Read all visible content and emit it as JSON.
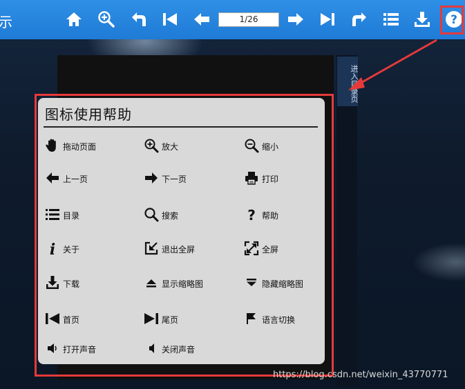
{
  "toolbar": {
    "left_partial_text": "示",
    "page_indicator": "1/26",
    "buttons": [
      "home-icon",
      "zoom-in-icon",
      "undo-icon",
      "first-page-icon",
      "prev-page-icon",
      "next-page-icon",
      "last-page-icon",
      "redo-icon",
      "contents-icon",
      "download-icon",
      "help-icon"
    ]
  },
  "side_tab": {
    "label": "进入目录页"
  },
  "dialog": {
    "title": "图标使用帮助",
    "items": [
      {
        "icon": "hand-icon",
        "label": "拖动页面"
      },
      {
        "icon": "zoom-in-icon",
        "label": "放大"
      },
      {
        "icon": "zoom-out-icon",
        "label": "缩小"
      },
      {
        "icon": "arrow-left-icon",
        "label": "上一页"
      },
      {
        "icon": "arrow-right-icon",
        "label": "下一页"
      },
      {
        "icon": "print-icon",
        "label": "打印"
      },
      {
        "icon": "list-icon",
        "label": "目录"
      },
      {
        "icon": "search-icon",
        "label": "搜索"
      },
      {
        "icon": "question-icon",
        "label": "帮助"
      },
      {
        "icon": "info-icon",
        "label": "关于"
      },
      {
        "icon": "exit-fullscreen-icon",
        "label": "退出全屏"
      },
      {
        "icon": "fullscreen-icon",
        "label": "全屏"
      },
      {
        "icon": "download-icon",
        "label": "下载"
      },
      {
        "icon": "show-thumbnails-icon",
        "label": "显示缩略图"
      },
      {
        "icon": "hide-thumbnails-icon",
        "label": "隐藏缩略图"
      },
      {
        "icon": "first-page-icon",
        "label": "首页"
      },
      {
        "icon": "last-page-icon",
        "label": "尾页"
      },
      {
        "icon": "flag-icon",
        "label": "语言切换"
      },
      {
        "icon": "sound-on-icon",
        "label": "打开声音"
      },
      {
        "icon": "sound-off-icon",
        "label": "关闭声音"
      }
    ]
  },
  "watermark": "https://blog.csdn.net/weixin_43770771",
  "colors": {
    "toolbar": "#1f7bd6",
    "highlight": "#e63a3a",
    "dialog_bg": "#d9d9d9"
  }
}
